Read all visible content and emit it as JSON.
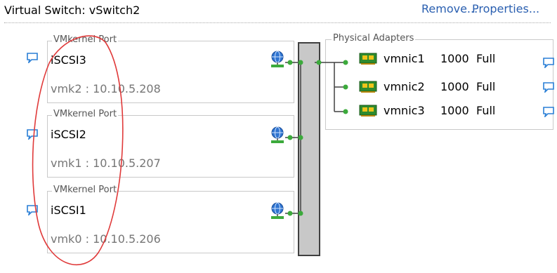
{
  "header": {
    "title": "Virtual Switch: vSwitch2",
    "remove_label": "Remove...",
    "properties_label": "Properties..."
  },
  "ports": [
    {
      "type_label": "VMkernel Port",
      "name": "iSCSI3",
      "vmk_address": "vmk2 : 10.10.5.208"
    },
    {
      "type_label": "VMkernel Port",
      "name": "iSCSI2",
      "vmk_address": "vmk1 : 10.10.5.207"
    },
    {
      "type_label": "VMkernel Port",
      "name": "iSCSI1",
      "vmk_address": "vmk0 : 10.10.5.206"
    }
  ],
  "physical_adapters": {
    "label": "Physical Adapters",
    "nics": [
      {
        "name": "vmnic1",
        "speed": "1000",
        "duplex": "Full"
      },
      {
        "name": "vmnic2",
        "speed": "1000",
        "duplex": "Full"
      },
      {
        "name": "vmnic3",
        "speed": "1000",
        "duplex": "Full"
      }
    ]
  },
  "colors": {
    "link": "#2a5fb0",
    "wire": "#404040",
    "node": "#3caa3c",
    "annotation": "#e03a3a"
  },
  "icons": {
    "port_info": "speech-bubble-icon",
    "port_network": "globe-network-icon",
    "nic": "network-card-icon"
  }
}
